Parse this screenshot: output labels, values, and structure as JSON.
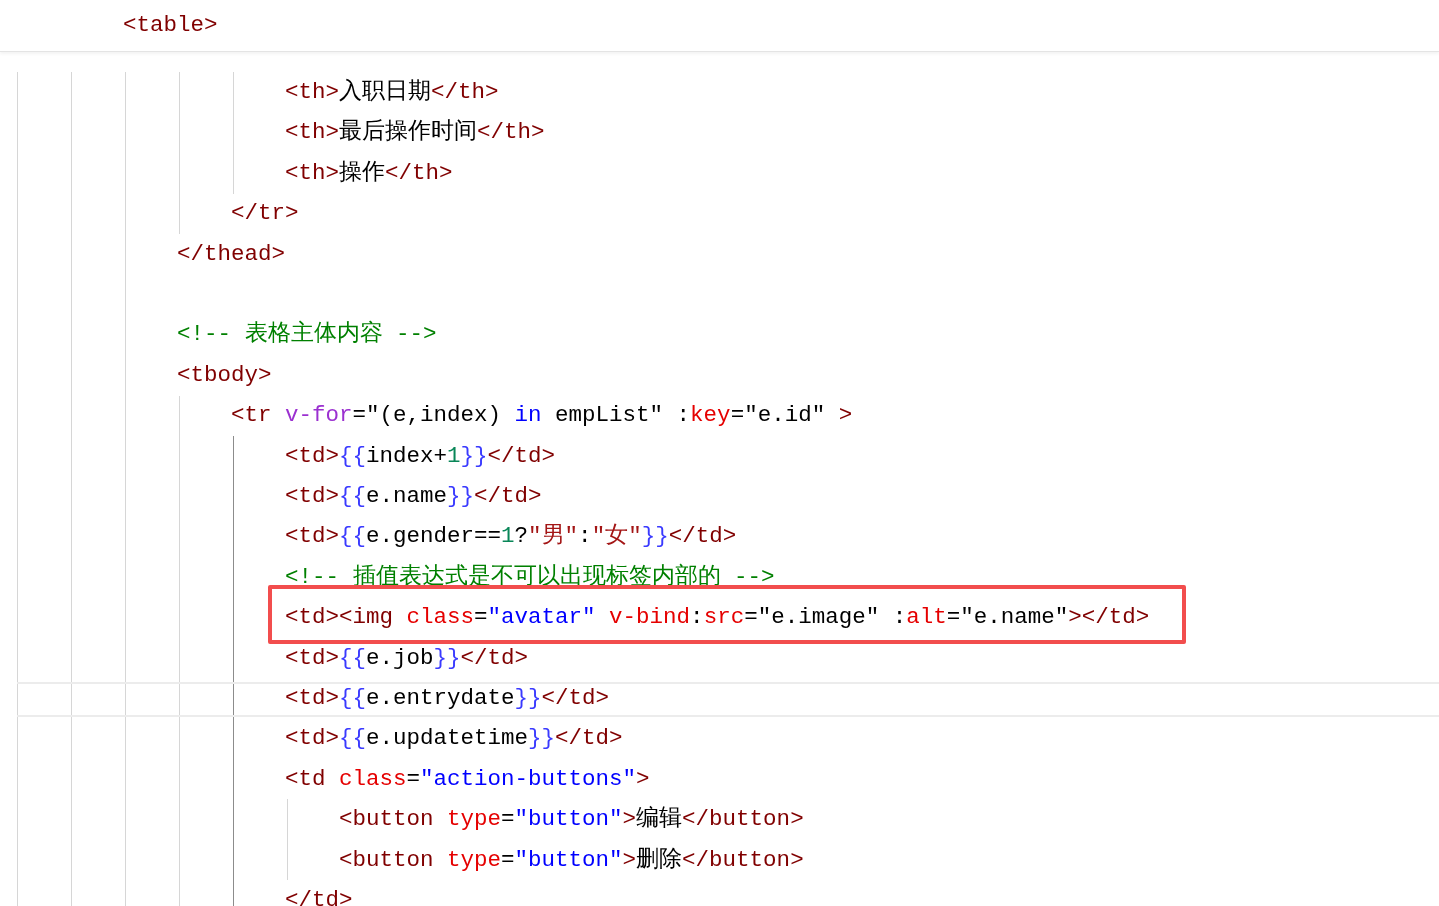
{
  "sticky_header": {
    "tokens": [
      {
        "kind": "tag",
        "text": "<table>"
      }
    ]
  },
  "code": [
    {
      "active": false,
      "children": [
        {
          "active": false,
          "children": [
            {
              "active": false,
              "children": [
                {
                  "active": false,
                  "children": [
                    {
                      "active": false,
                      "children": [
                        {
                          "current": false,
                          "marked": false,
                          "tokens": [
                            {
                              "kind": "tag",
                              "text": "<th>"
                            },
                            {
                              "kind": "text",
                              "text": "入职日期"
                            },
                            {
                              "kind": "tag",
                              "text": "</th>"
                            }
                          ]
                        },
                        {
                          "current": false,
                          "marked": false,
                          "tokens": [
                            {
                              "kind": "tag",
                              "text": "<th>"
                            },
                            {
                              "kind": "text",
                              "text": "最后操作时间"
                            },
                            {
                              "kind": "tag",
                              "text": "</th>"
                            }
                          ]
                        },
                        {
                          "current": false,
                          "marked": false,
                          "tokens": [
                            {
                              "kind": "tag",
                              "text": "<th>"
                            },
                            {
                              "kind": "text",
                              "text": "操作"
                            },
                            {
                              "kind": "tag",
                              "text": "</th>"
                            }
                          ]
                        }
                      ]
                    },
                    {
                      "current": false,
                      "marked": false,
                      "tokens": [
                        {
                          "kind": "tag",
                          "text": "</tr>"
                        }
                      ]
                    }
                  ]
                },
                {
                  "current": false,
                  "marked": false,
                  "tokens": [
                    {
                      "kind": "tag",
                      "text": "</thead>"
                    }
                  ]
                },
                {
                  "kind": "blank"
                },
                {
                  "current": false,
                  "marked": false,
                  "tokens": [
                    {
                      "kind": "comment",
                      "text": "<!-- 表格主体内容 -->"
                    }
                  ]
                },
                {
                  "current": false,
                  "marked": false,
                  "active": false,
                  "tokens": [
                    {
                      "kind": "tag",
                      "text": "<tbody>"
                    }
                  ],
                  "children": [
                    {
                      "current": false,
                      "marked": false,
                      "active": true,
                      "tokens": [
                        {
                          "kind": "tag",
                          "text": "<tr "
                        },
                        {
                          "kind": "directive",
                          "text": "v-for"
                        },
                        {
                          "kind": "text",
                          "text": "=\"(e,index) "
                        },
                        {
                          "kind": "keyword",
                          "text": "in"
                        },
                        {
                          "kind": "text",
                          "text": " empList\" :"
                        },
                        {
                          "kind": "attr",
                          "text": "key"
                        },
                        {
                          "kind": "text",
                          "text": "=\"e.id\" "
                        },
                        {
                          "kind": "tag",
                          "text": ">"
                        }
                      ],
                      "children": [
                        {
                          "current": false,
                          "marked": false,
                          "tokens": [
                            {
                              "kind": "tag",
                              "text": "<td>"
                            },
                            {
                              "kind": "brace",
                              "text": "{{"
                            },
                            {
                              "kind": "text",
                              "text": "index+"
                            },
                            {
                              "kind": "number",
                              "text": "1"
                            },
                            {
                              "kind": "brace",
                              "text": "}}"
                            },
                            {
                              "kind": "tag",
                              "text": "</td>"
                            }
                          ]
                        },
                        {
                          "current": false,
                          "marked": false,
                          "tokens": [
                            {
                              "kind": "tag",
                              "text": "<td>"
                            },
                            {
                              "kind": "brace",
                              "text": "{{"
                            },
                            {
                              "kind": "text",
                              "text": "e.name"
                            },
                            {
                              "kind": "brace",
                              "text": "}}"
                            },
                            {
                              "kind": "tag",
                              "text": "</td>"
                            }
                          ]
                        },
                        {
                          "current": false,
                          "marked": false,
                          "tokens": [
                            {
                              "kind": "tag",
                              "text": "<td>"
                            },
                            {
                              "kind": "brace",
                              "text": "{{"
                            },
                            {
                              "kind": "text",
                              "text": "e.gender=="
                            },
                            {
                              "kind": "number",
                              "text": "1"
                            },
                            {
                              "kind": "text",
                              "text": "?"
                            },
                            {
                              "kind": "literal",
                              "text": "\"男\""
                            },
                            {
                              "kind": "text",
                              "text": ":"
                            },
                            {
                              "kind": "literal",
                              "text": "\"女\""
                            },
                            {
                              "kind": "brace",
                              "text": "}}"
                            },
                            {
                              "kind": "tag",
                              "text": "</td>"
                            }
                          ]
                        },
                        {
                          "current": false,
                          "marked": false,
                          "tokens": [
                            {
                              "kind": "comment",
                              "text": "<!-- 插值表达式是不可以出现标签内部的 -->"
                            }
                          ]
                        },
                        {
                          "current": false,
                          "marked": true,
                          "tokens": [
                            {
                              "kind": "tag",
                              "text": "<td><img "
                            },
                            {
                              "kind": "attr",
                              "text": "class"
                            },
                            {
                              "kind": "text",
                              "text": "="
                            },
                            {
                              "kind": "string",
                              "text": "\"avatar\""
                            },
                            {
                              "kind": "attr",
                              "text": " v-bind"
                            },
                            {
                              "kind": "text",
                              "text": ":"
                            },
                            {
                              "kind": "attr",
                              "text": "src"
                            },
                            {
                              "kind": "text",
                              "text": "=\"e.image\" :"
                            },
                            {
                              "kind": "attr",
                              "text": "alt"
                            },
                            {
                              "kind": "text",
                              "text": "=\"e.name\""
                            },
                            {
                              "kind": "tag",
                              "text": "></td>"
                            }
                          ]
                        },
                        {
                          "current": false,
                          "marked": false,
                          "tokens": [
                            {
                              "kind": "tag",
                              "text": "<td>"
                            },
                            {
                              "kind": "brace",
                              "text": "{{"
                            },
                            {
                              "kind": "text",
                              "text": "e.job"
                            },
                            {
                              "kind": "brace",
                              "text": "}}"
                            },
                            {
                              "kind": "tag",
                              "text": "</td>"
                            }
                          ]
                        },
                        {
                          "current": true,
                          "marked": false,
                          "tokens": [
                            {
                              "kind": "tag",
                              "text": "<td>"
                            },
                            {
                              "kind": "brace",
                              "text": "{{"
                            },
                            {
                              "kind": "text",
                              "text": "e.entrydate"
                            },
                            {
                              "kind": "brace",
                              "text": "}}"
                            },
                            {
                              "kind": "tag",
                              "text": "</td>"
                            }
                          ]
                        },
                        {
                          "current": false,
                          "marked": false,
                          "tokens": [
                            {
                              "kind": "tag",
                              "text": "<td>"
                            },
                            {
                              "kind": "brace",
                              "text": "{{"
                            },
                            {
                              "kind": "text",
                              "text": "e.updatetime"
                            },
                            {
                              "kind": "brace",
                              "text": "}}"
                            },
                            {
                              "kind": "tag",
                              "text": "</td>"
                            }
                          ]
                        },
                        {
                          "current": false,
                          "marked": false,
                          "active": false,
                          "tokens": [
                            {
                              "kind": "tag",
                              "text": "<td "
                            },
                            {
                              "kind": "attr",
                              "text": "class"
                            },
                            {
                              "kind": "text",
                              "text": "="
                            },
                            {
                              "kind": "string",
                              "text": "\"action-buttons\""
                            },
                            {
                              "kind": "tag",
                              "text": ">"
                            }
                          ],
                          "children": [
                            {
                              "current": false,
                              "marked": false,
                              "tokens": [
                                {
                                  "kind": "tag",
                                  "text": "<button "
                                },
                                {
                                  "kind": "attr",
                                  "text": "type"
                                },
                                {
                                  "kind": "text",
                                  "text": "="
                                },
                                {
                                  "kind": "string",
                                  "text": "\"button\""
                                },
                                {
                                  "kind": "tag",
                                  "text": ">"
                                },
                                {
                                  "kind": "text",
                                  "text": "编辑"
                                },
                                {
                                  "kind": "tag",
                                  "text": "</button>"
                                }
                              ]
                            },
                            {
                              "current": false,
                              "marked": false,
                              "tokens": [
                                {
                                  "kind": "tag",
                                  "text": "<button "
                                },
                                {
                                  "kind": "attr",
                                  "text": "type"
                                },
                                {
                                  "kind": "text",
                                  "text": "="
                                },
                                {
                                  "kind": "string",
                                  "text": "\"button\""
                                },
                                {
                                  "kind": "tag",
                                  "text": ">"
                                },
                                {
                                  "kind": "text",
                                  "text": "删除"
                                },
                                {
                                  "kind": "tag",
                                  "text": "</button>"
                                }
                              ]
                            }
                          ]
                        },
                        {
                          "current": false,
                          "marked": false,
                          "tokens": [
                            {
                              "kind": "tag",
                              "text": "</td>"
                            }
                          ]
                        }
                      ]
                    }
                  ]
                }
              ]
            }
          ]
        }
      ]
    }
  ]
}
